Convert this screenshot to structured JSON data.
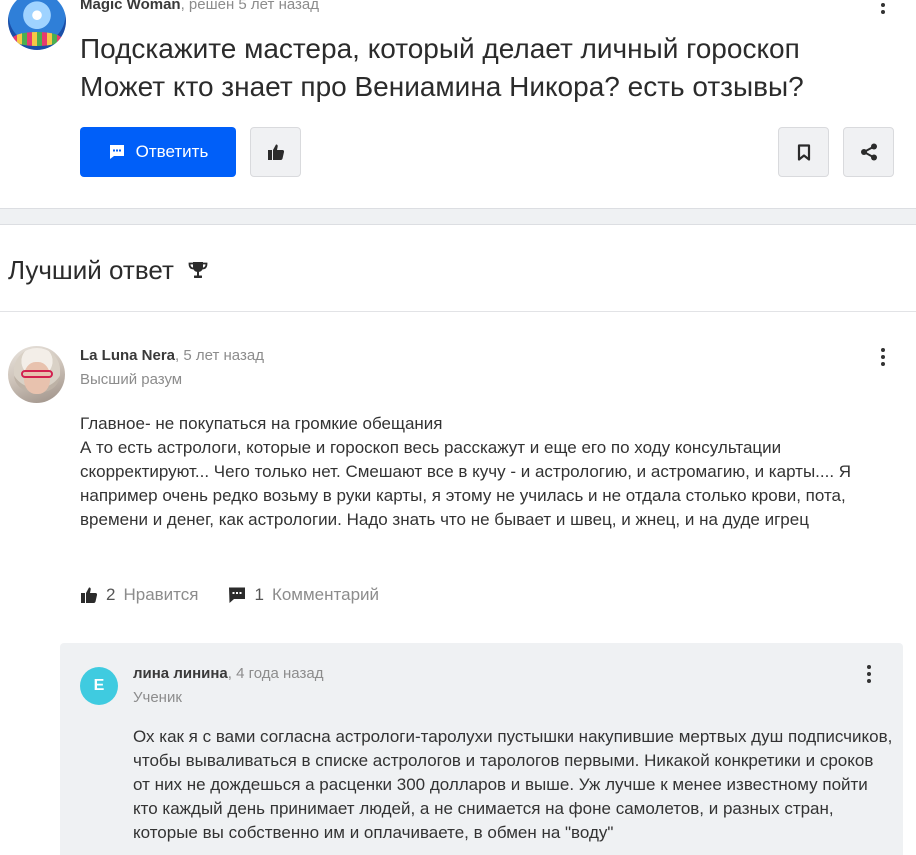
{
  "question": {
    "author": "Magic Woman",
    "meta": ", решен 5 лет назад",
    "title_line1": "Подскажите мастера, который делает личный гороскоп",
    "title_line2": "Может кто знает про Вениамина Никора? есть отзывы?",
    "reply_label": "Ответить",
    "icons": {
      "reply": "chat-icon",
      "like": "thumbs-up-icon",
      "bookmark": "bookmark-icon",
      "share": "share-icon",
      "menu": "more-vertical-icon"
    },
    "accent": "#005ff9"
  },
  "best_answer": {
    "heading": "Лучший ответ",
    "heading_icon": "trophy-icon",
    "author": "La Luna Nera",
    "meta": ", 5 лет назад",
    "rank": "Высший разум",
    "lines": [
      "Главное- не покупаться на громкие обещания",
      "А то есть астрологи, которые и гороскоп весь расскажут и еще его по ходу консультации скорректируют... Чего только нет. Смешают все в кучу - и астрологию, и астромагию, и карты.... Я например очень редко возьму в руки карты, я этому не училась и не отдала столько крови, пота, времени и денег, как астрологии. Надо знать что не бывает и швец, и жнец, и на дуде игрец"
    ],
    "likes_count": "2",
    "likes_label": "Нравится",
    "comments_count": "1",
    "comments_label": "Комментарий"
  },
  "comment": {
    "avatar_letter": "E",
    "avatar_color": "#3fcbe0",
    "author": "лина линина",
    "meta": ", 4 года назад",
    "rank": "Ученик",
    "text": "Ох как я с вами согласна астрологи-таролухи пустышки накупившие мертвых душ подписчиков, чтобы вываливаться в списке астрологов и тарологов первыми. Никакой конкретики и сроков от них не дождешься а расценки 300 долларов и выше. Уж лучше к менее известному пойти кто каждый день принимает людей, а не снимается на фоне самолетов, и разных стран, которые вы собственно им и оплачиваете, в обмен на \"воду\""
  }
}
